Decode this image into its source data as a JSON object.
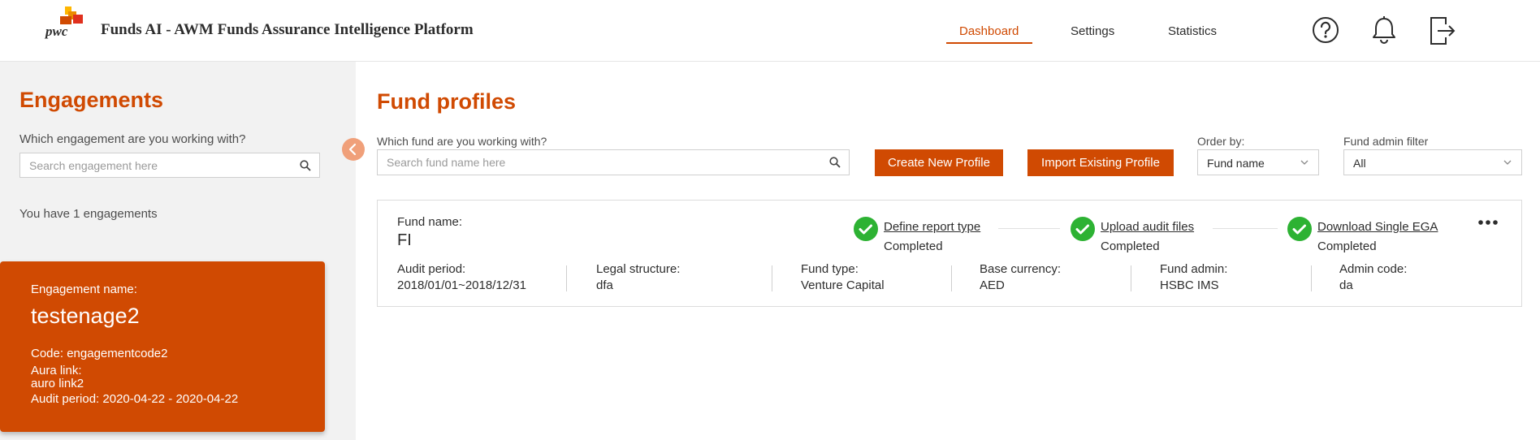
{
  "header": {
    "logo_text": "pwc",
    "title": "Funds AI - AWM Funds Assurance Intelligence Platform",
    "nav": [
      {
        "label": "Dashboard",
        "active": true
      },
      {
        "label": "Settings",
        "active": false
      },
      {
        "label": "Statistics",
        "active": false
      }
    ],
    "icons": [
      "help-icon",
      "bell-icon",
      "logout-icon"
    ]
  },
  "sidebar": {
    "title": "Engagements",
    "question": "Which engagement are you working with?",
    "search_placeholder": "Search engagement here",
    "count_text": "You have 1 engagements",
    "card": {
      "label": "Engagement name:",
      "name": "testenage2",
      "code": "Code: engagementcode2",
      "aura_label": "Aura link:",
      "aura_value": "auro link2",
      "audit_period": "Audit period: 2020-04-22 - 2020-04-22"
    }
  },
  "main": {
    "title": "Fund profiles",
    "question": "Which fund are you working with?",
    "search_placeholder": "Search fund name here",
    "create_button": "Create New Profile",
    "import_button": "Import Existing Profile",
    "order_by": {
      "label": "Order by:",
      "value": "Fund name"
    },
    "admin_filter": {
      "label": "Fund admin filter",
      "value": "All"
    }
  },
  "fund": {
    "name_label": "Fund name:",
    "name": "FI",
    "steps": [
      {
        "label": "Define report type",
        "status": "Completed"
      },
      {
        "label": "Upload audit files",
        "status": "Completed"
      },
      {
        "label": "Download Single EGA",
        "status": "Completed"
      }
    ],
    "details": [
      {
        "label": "Audit period:",
        "value": "2018/01/01~2018/12/31"
      },
      {
        "label": "Legal structure:",
        "value": "dfa"
      },
      {
        "label": "Fund type:",
        "value": "Venture Capital"
      },
      {
        "label": "Base currency:",
        "value": "AED"
      },
      {
        "label": "Fund admin:",
        "value": "HSBC IMS"
      },
      {
        "label": "Admin code:",
        "value": "da"
      }
    ]
  },
  "colors": {
    "accent": "#d04a02",
    "success": "#2db233",
    "sidebar_bg": "#f2f2f2"
  }
}
